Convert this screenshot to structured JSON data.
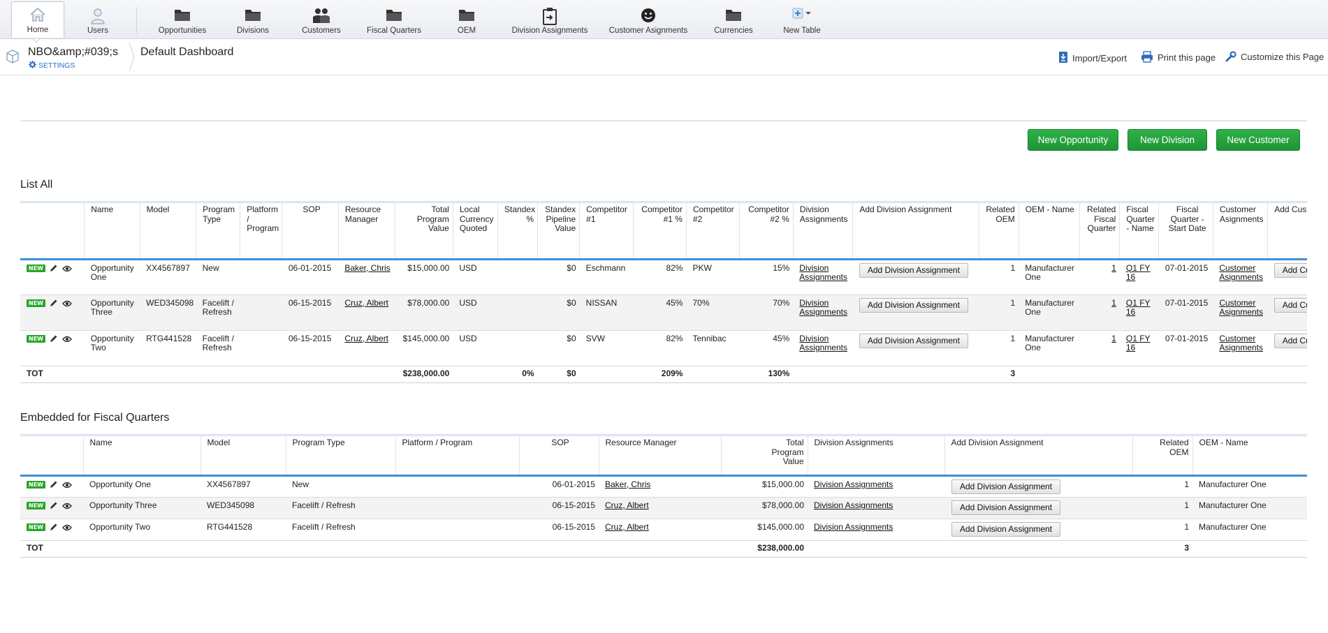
{
  "nav": {
    "items": [
      {
        "label": "Home",
        "icon": "home-icon"
      },
      {
        "label": "Users",
        "icon": "user-icon"
      },
      {
        "label": "Opportunities",
        "icon": "folder-icon"
      },
      {
        "label": "Divisions",
        "icon": "folder-icon"
      },
      {
        "label": "Customers",
        "icon": "people-icon"
      },
      {
        "label": "Fiscal Quarters",
        "icon": "folder-icon"
      },
      {
        "label": "OEM",
        "icon": "folder-icon"
      },
      {
        "label": "Division Assignments",
        "icon": "clipboard-icon"
      },
      {
        "label": "Customer Asignments",
        "icon": "smiley-icon"
      },
      {
        "label": "Currencies",
        "icon": "folder-icon"
      },
      {
        "label": "New Table",
        "icon": "add-table-icon"
      }
    ]
  },
  "header": {
    "app_title": "NBO&amp;#039;s",
    "settings_label": "SETTINGS",
    "dashboard_title": "Default Dashboard",
    "import_export": "Import/Export",
    "print_page": "Print this page",
    "customize_page": "Customize this Page"
  },
  "actions": {
    "new_opportunity": "New Opportunity",
    "new_division": "New Division",
    "new_customer": "New Customer"
  },
  "badge_new": "NEW",
  "add_division_label": "Add  Division Assignment",
  "add_customer_label": "Add  Custom",
  "list_all": {
    "title": "List All",
    "columns": [
      "Name",
      "Model",
      "Program Type",
      "Platform / Program",
      "SOP",
      "Resource Manager",
      "Total Program Value",
      "Local Currency Quoted",
      "Standex %",
      "Standex Pipeline Value",
      "Competitor #1",
      "Competitor #1 %",
      "Competitor #2",
      "Competitor #2 %",
      "Division Assignments",
      "Add Division Assignment",
      "Related OEM",
      "OEM - Name",
      "Related Fiscal Quarter",
      "Fiscal Quarter - Name",
      "Fiscal Quarter - Start Date",
      "Customer Asignments",
      "Add Customer"
    ],
    "rows": [
      {
        "name": "Opportunity One",
        "model": "XX4567897",
        "program_type": "New",
        "platform": "",
        "sop": "06-01-2015",
        "resource_manager": "Baker, Chris",
        "total_value": "$15,000.00",
        "currency": "USD",
        "standex_pct": "",
        "pipeline_value": "$0",
        "competitor1": "Eschmann",
        "competitor1_pct": "82%",
        "competitor2": "PKW",
        "competitor2_pct": "15%",
        "division_assignments": "Division Assignments",
        "related_oem": "1",
        "oem_name": "Manufacturer One",
        "related_fq": "1",
        "fq_name": "Q1 FY 16",
        "fq_start": "07-01-2015",
        "customer_asignments": "Customer Asignments"
      },
      {
        "name": "Opportunity Three",
        "model": "WED345098",
        "program_type": "Facelift / Refresh",
        "platform": "",
        "sop": "06-15-2015",
        "resource_manager": "Cruz, Albert",
        "total_value": "$78,000.00",
        "currency": "USD",
        "standex_pct": "",
        "pipeline_value": "$0",
        "competitor1": "NISSAN",
        "competitor1_pct": "45%",
        "competitor2": "70%",
        "competitor2_pct": "70%",
        "division_assignments": "Division Assignments",
        "related_oem": "1",
        "oem_name": "Manufacturer One",
        "related_fq": "1",
        "fq_name": "Q1 FY 16",
        "fq_start": "07-01-2015",
        "customer_asignments": "Customer Asignments"
      },
      {
        "name": "Opportunity Two",
        "model": "RTG441528",
        "program_type": "Facelift / Refresh",
        "platform": "",
        "sop": "06-15-2015",
        "resource_manager": "Cruz, Albert",
        "total_value": "$145,000.00",
        "currency": "USD",
        "standex_pct": "",
        "pipeline_value": "$0",
        "competitor1": "SVW",
        "competitor1_pct": "82%",
        "competitor2": "Tennibac",
        "competitor2_pct": "45%",
        "division_assignments": "Division Assignments",
        "related_oem": "1",
        "oem_name": "Manufacturer One",
        "related_fq": "1",
        "fq_name": "Q1 FY 16",
        "fq_start": "07-01-2015",
        "customer_asignments": "Customer Asignments"
      }
    ],
    "totals": {
      "label": "TOT",
      "total_value": "$238,000.00",
      "standex_pct": "0%",
      "pipeline_value": "$0",
      "competitor1_pct": "209%",
      "competitor2_pct": "130%",
      "related_oem": "3"
    }
  },
  "fiscal": {
    "title": "Embedded for Fiscal Quarters",
    "columns": [
      "Name",
      "Model",
      "Program Type",
      "Platform / Program",
      "SOP",
      "Resource Manager",
      "Total Program Value",
      "Division Assignments",
      "Add Division Assignment",
      "Related OEM",
      "OEM - Name"
    ],
    "rows": [
      {
        "name": "Opportunity One",
        "model": "XX4567897",
        "program_type": "New",
        "platform": "",
        "sop": "06-01-2015",
        "resource_manager": "Baker, Chris",
        "total_value": "$15,000.00",
        "division_assignments": "Division Assignments",
        "related_oem": "1",
        "oem_name": "Manufacturer One"
      },
      {
        "name": "Opportunity Three",
        "model": "WED345098",
        "program_type": "Facelift / Refresh",
        "platform": "",
        "sop": "06-15-2015",
        "resource_manager": "Cruz, Albert",
        "total_value": "$78,000.00",
        "division_assignments": "Division Assignments",
        "related_oem": "1",
        "oem_name": "Manufacturer One"
      },
      {
        "name": "Opportunity Two",
        "model": "RTG441528",
        "program_type": "Facelift / Refresh",
        "platform": "",
        "sop": "06-15-2015",
        "resource_manager": "Cruz, Albert",
        "total_value": "$145,000.00",
        "division_assignments": "Division Assignments",
        "related_oem": "1",
        "oem_name": "Manufacturer One"
      }
    ],
    "totals": {
      "label": "TOT",
      "total_value": "$238,000.00",
      "related_oem": "3"
    }
  }
}
